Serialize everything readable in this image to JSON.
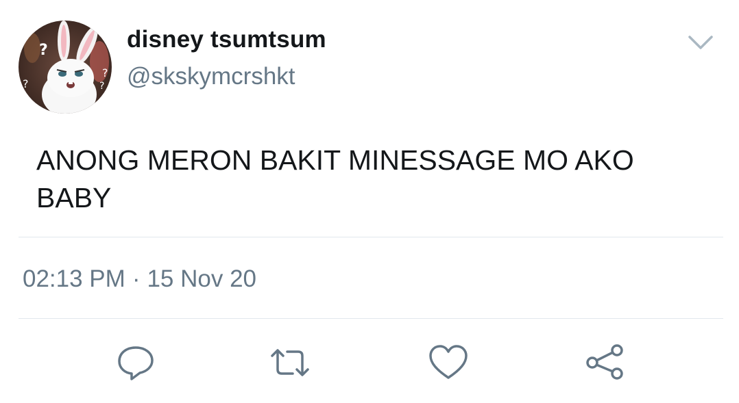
{
  "user": {
    "display_name": "disney tsumtsum",
    "handle": "@skskymcrshkt"
  },
  "tweet": {
    "text": "ANONG MERON BAKIT MINESSAGE MO AKO BABY",
    "time": "02:13 PM",
    "separator": "·",
    "date": "15 Nov 20"
  },
  "icons": {
    "menu": "chevron-down-icon",
    "reply": "reply-icon",
    "retweet": "retweet-icon",
    "like": "heart-icon",
    "share": "share-icon"
  },
  "colors": {
    "text": "#14171a",
    "secondary": "#657786",
    "divider": "#e1e8ed",
    "caret": "#aab8c2"
  }
}
